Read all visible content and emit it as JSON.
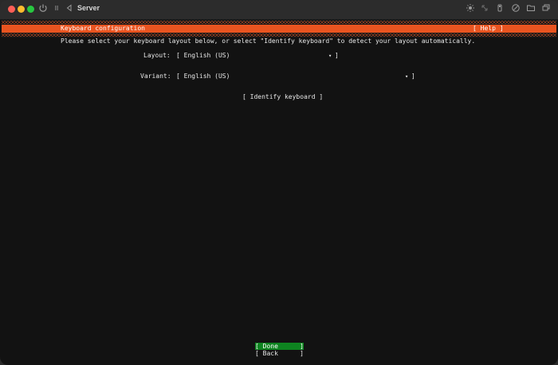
{
  "window": {
    "title": "Server"
  },
  "header": {
    "title": "Keyboard configuration",
    "help": "[ Help ]",
    "color": "#e95420"
  },
  "intro": "Please select your keyboard layout below, or select \"Identify keyboard\" to detect your layout automatically.",
  "layout": {
    "label": "Layout:",
    "value": "[ English (US)",
    "arrow": "▾",
    "close": "]"
  },
  "variant": {
    "label": "Variant:",
    "value": "[ English (US)",
    "arrow": "▾",
    "close": "]"
  },
  "identify_button": "[ Identify keyboard ]",
  "buttons": {
    "done_open": "[ Done",
    "done_close": "]",
    "back_open": "[ Back",
    "back_close": "]",
    "done_color": "#0e8420"
  }
}
